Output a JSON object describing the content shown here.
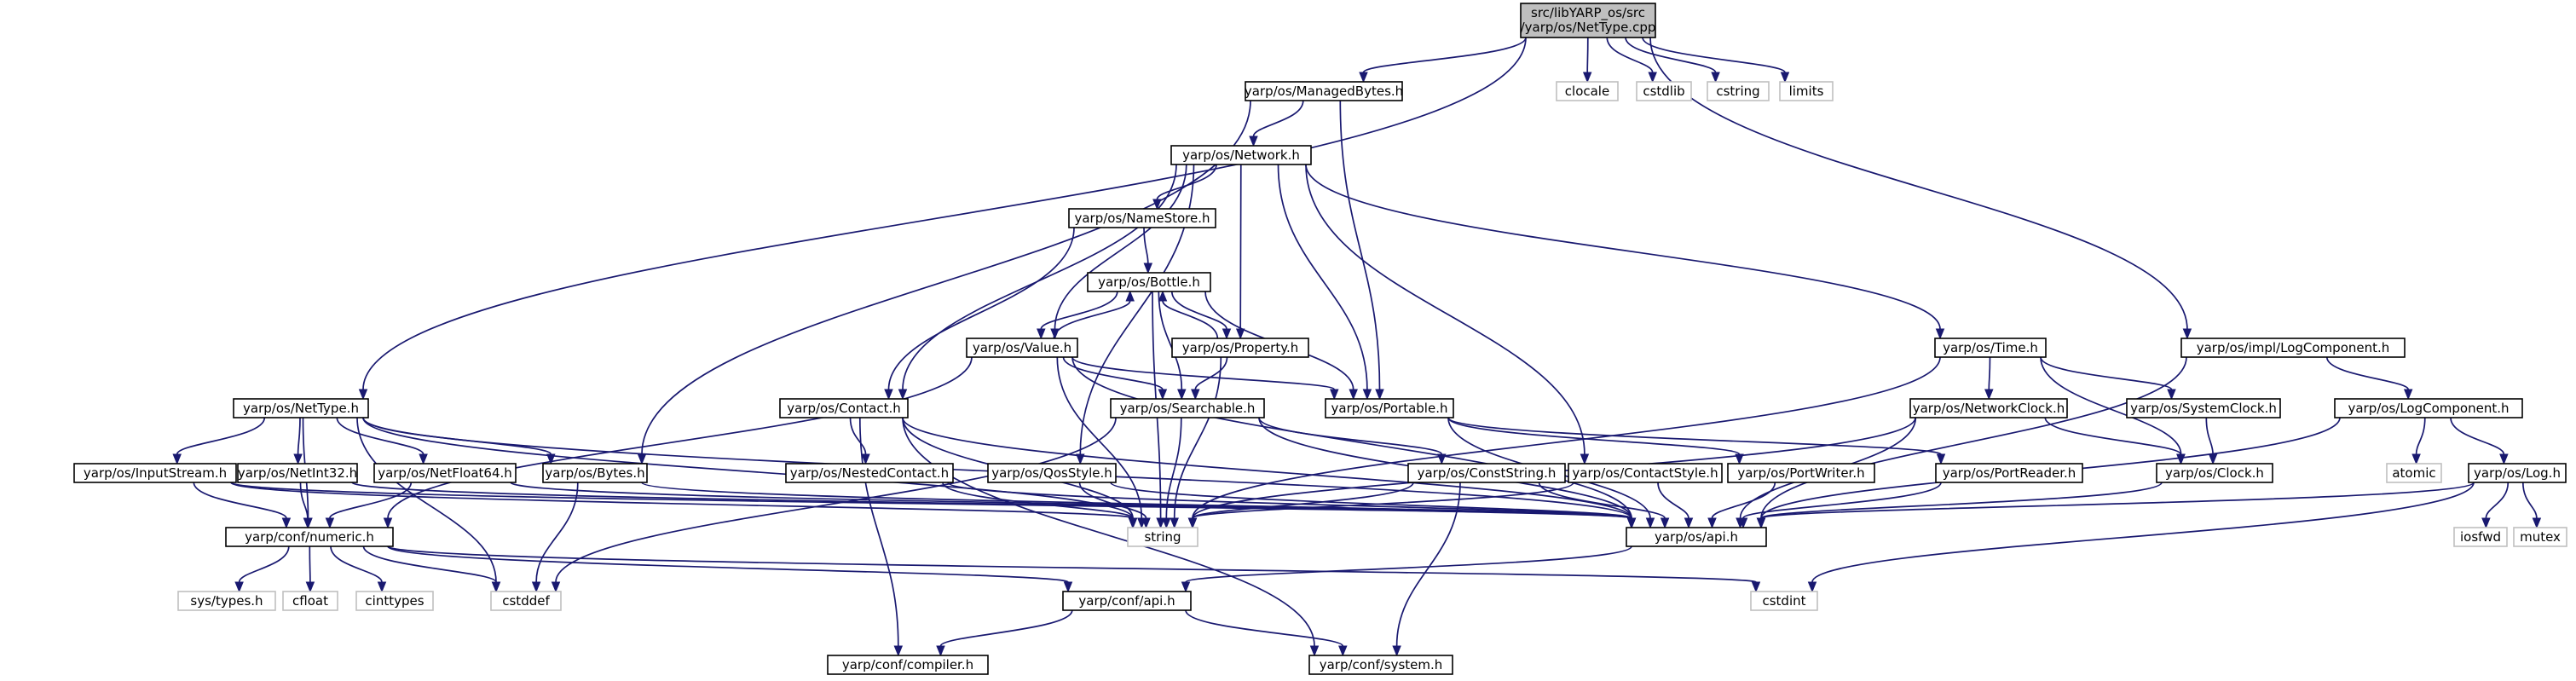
{
  "diagram": {
    "colors": {
      "edge": "#191970",
      "src_fill": "#bfbfbf",
      "node_border": "#000000",
      "system_border": "#bfbfbf"
    },
    "nodes": {
      "src": {
        "label": [
          "src/libYARP_os/src",
          "/yarp/os/NetType.cpp"
        ],
        "kind": "src"
      },
      "managedbytes": {
        "label": [
          "yarp/os/ManagedBytes.h"
        ],
        "kind": "local"
      },
      "clocale": {
        "label": [
          "clocale"
        ],
        "kind": "sys"
      },
      "cstdlib": {
        "label": [
          "cstdlib"
        ],
        "kind": "sys"
      },
      "cstring": {
        "label": [
          "cstring"
        ],
        "kind": "sys"
      },
      "limits": {
        "label": [
          "limits"
        ],
        "kind": "sys"
      },
      "network": {
        "label": [
          "yarp/os/Network.h"
        ],
        "kind": "local"
      },
      "namestore": {
        "label": [
          "yarp/os/NameStore.h"
        ],
        "kind": "local"
      },
      "bottle": {
        "label": [
          "yarp/os/Bottle.h"
        ],
        "kind": "local"
      },
      "value": {
        "label": [
          "yarp/os/Value.h"
        ],
        "kind": "local"
      },
      "property": {
        "label": [
          "yarp/os/Property.h"
        ],
        "kind": "local"
      },
      "time": {
        "label": [
          "yarp/os/Time.h"
        ],
        "kind": "local"
      },
      "impllog": {
        "label": [
          "yarp/os/impl/LogComponent.h"
        ],
        "kind": "local"
      },
      "nettype": {
        "label": [
          "yarp/os/NetType.h"
        ],
        "kind": "local"
      },
      "contact": {
        "label": [
          "yarp/os/Contact.h"
        ],
        "kind": "local"
      },
      "searchable": {
        "label": [
          "yarp/os/Searchable.h"
        ],
        "kind": "local"
      },
      "portable": {
        "label": [
          "yarp/os/Portable.h"
        ],
        "kind": "local"
      },
      "networkclock": {
        "label": [
          "yarp/os/NetworkClock.h"
        ],
        "kind": "local"
      },
      "systemclock": {
        "label": [
          "yarp/os/SystemClock.h"
        ],
        "kind": "local"
      },
      "logcomponent": {
        "label": [
          "yarp/os/LogComponent.h"
        ],
        "kind": "local"
      },
      "inputstream": {
        "label": [
          "yarp/os/InputStream.h"
        ],
        "kind": "local"
      },
      "netint32": {
        "label": [
          "yarp/os/NetInt32.h"
        ],
        "kind": "local"
      },
      "netfloat64": {
        "label": [
          "yarp/os/NetFloat64.h"
        ],
        "kind": "local"
      },
      "bytes": {
        "label": [
          "yarp/os/Bytes.h"
        ],
        "kind": "local"
      },
      "nestedcontact": {
        "label": [
          "yarp/os/NestedContact.h"
        ],
        "kind": "local"
      },
      "qosstyle": {
        "label": [
          "yarp/os/QosStyle.h"
        ],
        "kind": "local"
      },
      "conststring": {
        "label": [
          "yarp/os/ConstString.h"
        ],
        "kind": "local"
      },
      "contactstyle": {
        "label": [
          "yarp/os/ContactStyle.h"
        ],
        "kind": "local"
      },
      "portwriter": {
        "label": [
          "yarp/os/PortWriter.h"
        ],
        "kind": "local"
      },
      "portreader": {
        "label": [
          "yarp/os/PortReader.h"
        ],
        "kind": "local"
      },
      "clock": {
        "label": [
          "yarp/os/Clock.h"
        ],
        "kind": "local"
      },
      "atomic": {
        "label": [
          "atomic"
        ],
        "kind": "sys"
      },
      "log": {
        "label": [
          "yarp/os/Log.h"
        ],
        "kind": "local"
      },
      "numeric": {
        "label": [
          "yarp/conf/numeric.h"
        ],
        "kind": "local"
      },
      "string": {
        "label": [
          "string"
        ],
        "kind": "sys"
      },
      "osapi": {
        "label": [
          "yarp/os/api.h"
        ],
        "kind": "local"
      },
      "iosfwd": {
        "label": [
          "iosfwd"
        ],
        "kind": "sys"
      },
      "mutex": {
        "label": [
          "mutex"
        ],
        "kind": "sys"
      },
      "systypes": {
        "label": [
          "sys/types.h"
        ],
        "kind": "sys"
      },
      "cfloat": {
        "label": [
          "cfloat"
        ],
        "kind": "sys"
      },
      "cinttypes": {
        "label": [
          "cinttypes"
        ],
        "kind": "sys"
      },
      "cstddef": {
        "label": [
          "cstddef"
        ],
        "kind": "sys"
      },
      "cstdint": {
        "label": [
          "cstdint"
        ],
        "kind": "sys"
      },
      "confapi": {
        "label": [
          "yarp/conf/api.h"
        ],
        "kind": "local"
      },
      "compiler": {
        "label": [
          "yarp/conf/compiler.h"
        ],
        "kind": "local"
      },
      "system": {
        "label": [
          "yarp/conf/system.h"
        ],
        "kind": "local"
      }
    },
    "edges": [
      [
        "src",
        "managedbytes"
      ],
      [
        "src",
        "clocale"
      ],
      [
        "src",
        "cstdlib"
      ],
      [
        "src",
        "cstring"
      ],
      [
        "src",
        "limits"
      ],
      [
        "src",
        "nettype"
      ],
      [
        "src",
        "impllog"
      ],
      [
        "managedbytes",
        "network"
      ],
      [
        "managedbytes",
        "bytes"
      ],
      [
        "managedbytes",
        "portable"
      ],
      [
        "network",
        "namestore"
      ],
      [
        "network",
        "value"
      ],
      [
        "network",
        "property"
      ],
      [
        "network",
        "contact"
      ],
      [
        "network",
        "portable"
      ],
      [
        "network",
        "time"
      ],
      [
        "network",
        "qosstyle"
      ],
      [
        "network",
        "contactstyle"
      ],
      [
        "namestore",
        "bottle"
      ],
      [
        "namestore",
        "contact"
      ],
      [
        "bottle",
        "value"
      ],
      [
        "bottle",
        "property"
      ],
      [
        "bottle",
        "searchable"
      ],
      [
        "bottle",
        "portable"
      ],
      [
        "bottle",
        "string"
      ],
      [
        "value",
        "bottle"
      ],
      [
        "value",
        "searchable"
      ],
      [
        "value",
        "portable"
      ],
      [
        "value",
        "string"
      ],
      [
        "value",
        "numeric"
      ],
      [
        "value",
        "osapi"
      ],
      [
        "property",
        "bottle"
      ],
      [
        "property",
        "searchable"
      ],
      [
        "property",
        "string"
      ],
      [
        "searchable",
        "cstddef"
      ],
      [
        "searchable",
        "string"
      ],
      [
        "searchable",
        "conststring"
      ],
      [
        "searchable",
        "osapi"
      ],
      [
        "portable",
        "portwriter"
      ],
      [
        "portable",
        "portreader"
      ],
      [
        "portable",
        "osapi"
      ],
      [
        "contact",
        "nestedcontact"
      ],
      [
        "contact",
        "string"
      ],
      [
        "contact",
        "osapi"
      ],
      [
        "contact",
        "compiler"
      ],
      [
        "contact",
        "system"
      ],
      [
        "nestedcontact",
        "string"
      ],
      [
        "nestedcontact",
        "osapi"
      ],
      [
        "qosstyle",
        "string"
      ],
      [
        "qosstyle",
        "osapi"
      ],
      [
        "contactstyle",
        "string"
      ],
      [
        "contactstyle",
        "osapi"
      ],
      [
        "conststring",
        "string"
      ],
      [
        "conststring",
        "osapi"
      ],
      [
        "conststring",
        "system"
      ],
      [
        "portwriter",
        "osapi"
      ],
      [
        "portreader",
        "osapi"
      ],
      [
        "time",
        "networkclock"
      ],
      [
        "time",
        "systemclock"
      ],
      [
        "time",
        "clock"
      ],
      [
        "time",
        "string"
      ],
      [
        "networkclock",
        "clock"
      ],
      [
        "networkclock",
        "string"
      ],
      [
        "networkclock",
        "osapi"
      ],
      [
        "systemclock",
        "clock"
      ],
      [
        "clock",
        "osapi"
      ],
      [
        "impllog",
        "logcomponent"
      ],
      [
        "impllog",
        "osapi"
      ],
      [
        "logcomponent",
        "atomic"
      ],
      [
        "logcomponent",
        "log"
      ],
      [
        "logcomponent",
        "osapi"
      ],
      [
        "log",
        "osapi"
      ],
      [
        "log",
        "iosfwd"
      ],
      [
        "log",
        "mutex"
      ],
      [
        "log",
        "cstdint"
      ],
      [
        "nettype",
        "inputstream"
      ],
      [
        "nettype",
        "netint32"
      ],
      [
        "nettype",
        "netfloat64"
      ],
      [
        "nettype",
        "bytes"
      ],
      [
        "nettype",
        "numeric"
      ],
      [
        "nettype",
        "osapi"
      ],
      [
        "nettype",
        "string"
      ],
      [
        "nettype",
        "cstddef"
      ],
      [
        "inputstream",
        "numeric"
      ],
      [
        "inputstream",
        "string"
      ],
      [
        "inputstream",
        "osapi"
      ],
      [
        "netint32",
        "numeric"
      ],
      [
        "netint32",
        "osapi"
      ],
      [
        "netfloat64",
        "numeric"
      ],
      [
        "netfloat64",
        "osapi"
      ],
      [
        "bytes",
        "cstddef"
      ],
      [
        "bytes",
        "osapi"
      ],
      [
        "numeric",
        "systypes"
      ],
      [
        "numeric",
        "cfloat"
      ],
      [
        "numeric",
        "cinttypes"
      ],
      [
        "numeric",
        "cstddef"
      ],
      [
        "numeric",
        "cstdint"
      ],
      [
        "numeric",
        "confapi"
      ],
      [
        "osapi",
        "confapi"
      ],
      [
        "confapi",
        "compiler"
      ],
      [
        "confapi",
        "system"
      ]
    ]
  }
}
